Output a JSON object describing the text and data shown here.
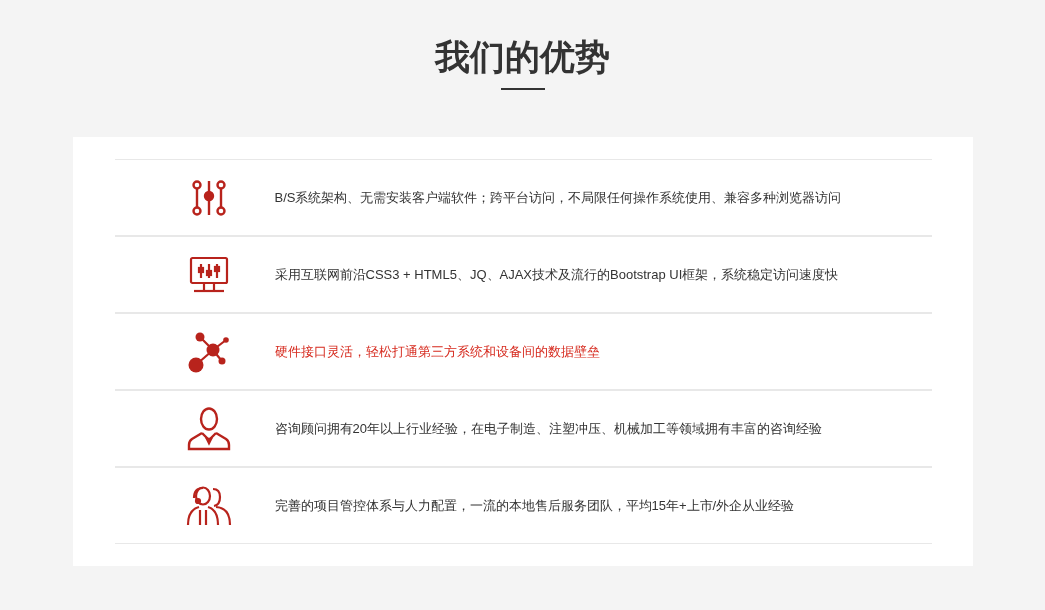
{
  "title": "我们的优势",
  "items": [
    {
      "kind": "sliders",
      "text": "B/S系统架构、无需安装客户端软件；跨平台访问，不局限任何操作系统使用、兼容多种浏览器访问",
      "selected": false
    },
    {
      "kind": "monitor",
      "text": "采用互联网前沿CSS3 + HTML5、JQ、AJAX技术及流行的Bootstrap UI框架，系统稳定访问速度快",
      "selected": false
    },
    {
      "kind": "network",
      "text": "硬件接口灵活，轻松打通第三方系统和设备间的数据壁垒",
      "selected": true
    },
    {
      "kind": "person",
      "text": "咨询顾问拥有20年以上行业经验，在电子制造、注塑冲压、机械加工等领域拥有丰富的咨询经验",
      "selected": false
    },
    {
      "kind": "group",
      "text": "完善的项目管控体系与人力配置，一流的本地售后服务团队，平均15年+上市/外企从业经验",
      "selected": false
    }
  ]
}
